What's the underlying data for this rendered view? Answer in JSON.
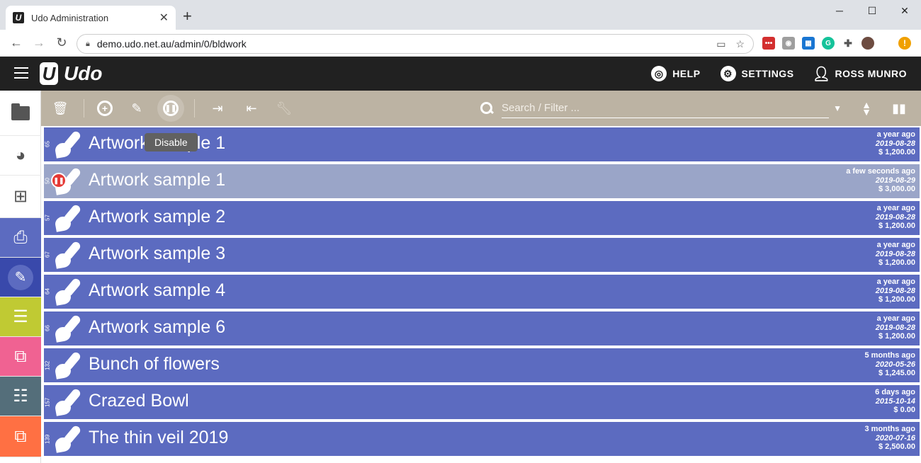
{
  "browser": {
    "tab_title": "Udo Administration",
    "tab_close": "✕",
    "new_tab": "+",
    "url": "demo.udo.net.au/admin/0/bldwork",
    "win_minimize": "─",
    "win_maximize": "☐",
    "win_close": "✕"
  },
  "app": {
    "logo_letter": "U",
    "logo_text": "Udo",
    "header": {
      "help_label": "HELP",
      "settings_label": "SETTINGS",
      "user_label": "ROSS MUNRO"
    },
    "search": {
      "placeholder": "Search / Filter ..."
    },
    "tooltip": "Disable"
  },
  "sidebar": [
    {
      "name": "folder",
      "bg": "#ffffff"
    },
    {
      "name": "palette",
      "bg": "#ffffff"
    },
    {
      "name": "gift",
      "bg": "#ffffff"
    },
    {
      "name": "printer",
      "bg": "#5c6bc0"
    },
    {
      "name": "brush",
      "bg": "#3949ab"
    },
    {
      "name": "list",
      "bg": "#c0ca33"
    },
    {
      "name": "frame",
      "bg": "#f06292"
    },
    {
      "name": "numbered-list",
      "bg": "#546e7a"
    },
    {
      "name": "frame-orange",
      "bg": "#ff7043"
    }
  ],
  "rows": [
    {
      "id": "65",
      "title": "Artwork sample 1",
      "ago": "a year ago",
      "date": "2019-08-28",
      "amount": "$ 1,200.00",
      "selected": false,
      "disabled": false
    },
    {
      "id": "50",
      "title": "Artwork sample 1",
      "ago": "a few seconds ago",
      "date": "2019-08-29",
      "amount": "$ 3,000.00",
      "selected": true,
      "disabled": true
    },
    {
      "id": "57",
      "title": "Artwork sample 2",
      "ago": "a year ago",
      "date": "2019-08-28",
      "amount": "$ 1,200.00",
      "selected": false,
      "disabled": false
    },
    {
      "id": "67",
      "title": "Artwork sample 3",
      "ago": "a year ago",
      "date": "2019-08-28",
      "amount": "$ 1,200.00",
      "selected": false,
      "disabled": false
    },
    {
      "id": "64",
      "title": "Artwork sample 4",
      "ago": "a year ago",
      "date": "2019-08-28",
      "amount": "$ 1,200.00",
      "selected": false,
      "disabled": false
    },
    {
      "id": "66",
      "title": "Artwork sample 6",
      "ago": "a year ago",
      "date": "2019-08-28",
      "amount": "$ 1,200.00",
      "selected": false,
      "disabled": false
    },
    {
      "id": "132",
      "title": "Bunch of flowers",
      "ago": "5 months ago",
      "date": "2020-05-26",
      "amount": "$ 1,245.00",
      "selected": false,
      "disabled": false
    },
    {
      "id": "157",
      "title": "Crazed Bowl",
      "ago": "6 days ago",
      "date": "2015-10-14",
      "amount": "$ 0.00",
      "selected": false,
      "disabled": false
    },
    {
      "id": "139",
      "title": "The thin veil 2019",
      "ago": "3 months ago",
      "date": "2020-07-16",
      "amount": "$ 2,500.00",
      "selected": false,
      "disabled": false
    }
  ]
}
